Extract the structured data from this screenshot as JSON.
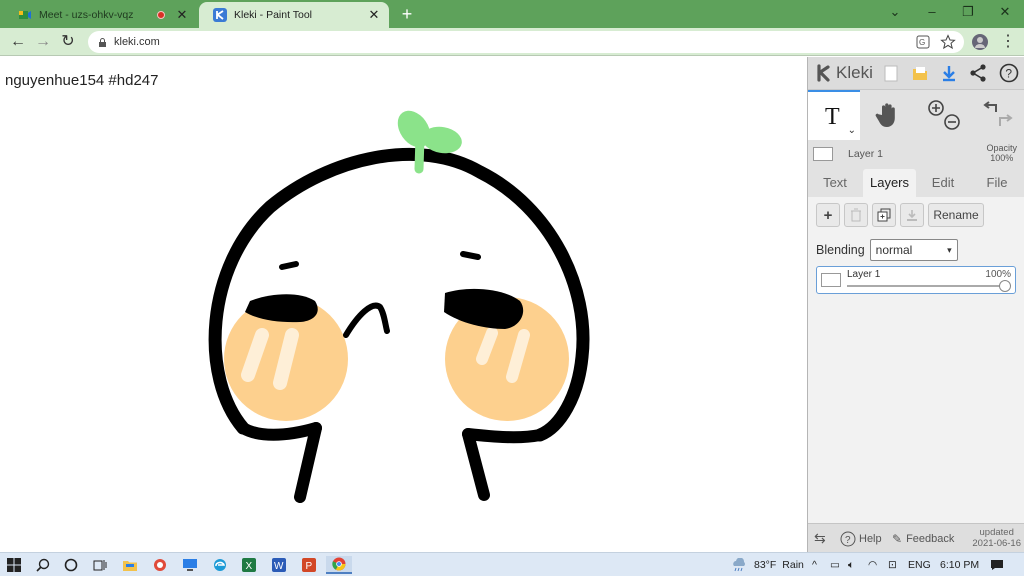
{
  "browser": {
    "tabs": [
      {
        "title": "Meet - uzs-ohkv-vqz",
        "active": false
      },
      {
        "title": "Kleki - Paint Tool",
        "active": true
      }
    ],
    "new_tab": "+",
    "window_controls": [
      "⌄",
      "–",
      "❐",
      "✕"
    ],
    "url": "kleki.com"
  },
  "canvas": {
    "label": "nguyenhue154 #hd247"
  },
  "kleki": {
    "logo_text": "Kleki",
    "current_layer_name": "Layer 1",
    "opacity_label": "Opacity",
    "opacity_value": "100%",
    "tabs": [
      "Text",
      "Layers",
      "Edit",
      "File"
    ],
    "active_tab": "Layers",
    "rename_label": "Rename",
    "blending_label": "Blending",
    "blending_value": "normal",
    "layers": [
      {
        "name": "Layer 1",
        "opacity": "100%",
        "opacity_fraction": 1.0
      }
    ],
    "help_label": "Help",
    "feedback_label": "Feedback",
    "updated_label": "updated",
    "updated_date": "2021-06-16"
  },
  "taskbar": {
    "weather_temp": "83°F",
    "weather_text": "Rain",
    "language": "ENG",
    "time": "6:10 PM"
  },
  "colors": {
    "accent": "#3a8ee6",
    "chrome_frame": "#5ea25b",
    "sprout": "#8be38a",
    "blush": "#fdd08e"
  }
}
